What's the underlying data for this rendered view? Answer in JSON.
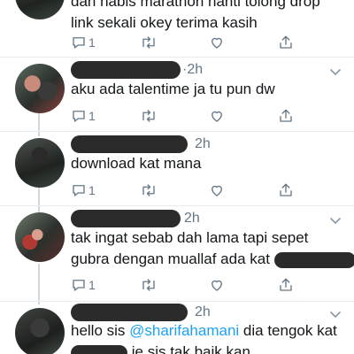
{
  "tweets": [
    {
      "lines": [
        "dah habis marathon nanti tolong drop",
        "link sekali okey terima kasih"
      ],
      "reply_count": "1"
    },
    {
      "time": "·2h",
      "text": "aku ada talentime ja tu pun dw",
      "reply_count": "1"
    },
    {
      "time": "2h",
      "text": "download kat mana",
      "reply_count": "1"
    },
    {
      "time": "2h",
      "line1": "tak ingat sebab dah lama tapi sepet",
      "line2": "gubra dengan muallaf ada kat",
      "reply_count": "1"
    },
    {
      "time": "2h",
      "line1_pre": "hello sis ",
      "mention": "@sharifahamani",
      "line1_post": " dia tengok kat",
      "line2": "je sis tak baik kan"
    }
  ],
  "icons": {
    "reply": "reply-icon",
    "retweet": "retweet-icon",
    "like": "heart-icon",
    "share": "share-icon",
    "more": "chevron-down-icon"
  },
  "colors": {
    "text": "#14171a",
    "muted": "#657786",
    "mention": "#1da1f2",
    "thread_line": "#cfd9de",
    "divider": "#e6ecf0"
  }
}
